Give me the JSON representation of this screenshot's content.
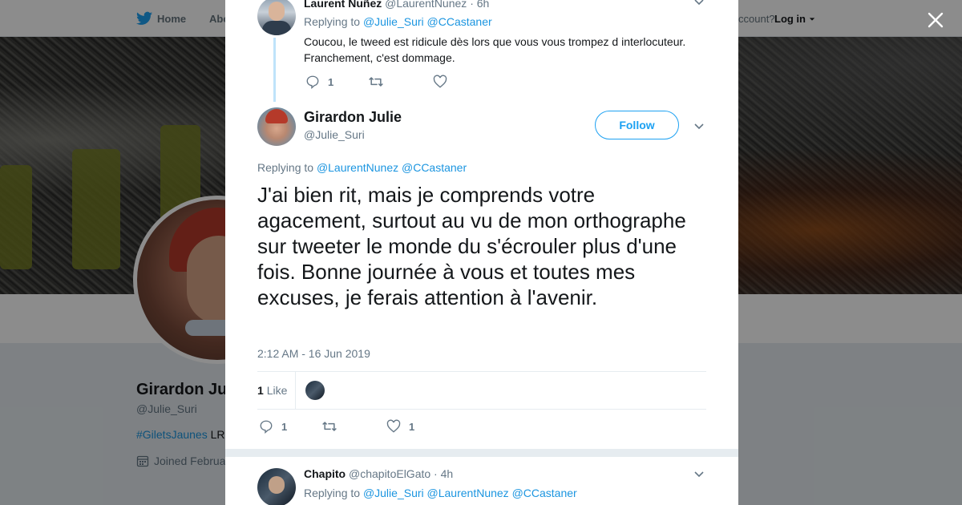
{
  "nav": {
    "home_label": "Home",
    "about_label": "Abo",
    "account_text": "ccount?",
    "login_label": "Log in"
  },
  "profile": {
    "name": "Girardon Ju",
    "handle": "@Julie_Suri",
    "bio_hashtag": "#GiletsJaunes",
    "bio_rest": " LR",
    "joined": "Joined Februa"
  },
  "modal": {
    "parent_tweet": {
      "name": "Laurent Nuñez",
      "handle": "@LaurentNunez",
      "time": "· 6h",
      "replying_prefix": "Replying to",
      "replying_1": "@Julie_Suri",
      "replying_2": "@CCastaner",
      "text_line1": "Coucou, le tweed est ridicule dès lors que vous vous trompez d interlocuteur.",
      "text_line2": "Franchement, c'est dommage.",
      "reply_count": "1",
      "retweet_count": "",
      "like_count": ""
    },
    "main_tweet": {
      "name": "Girardon Julie",
      "handle": "@Julie_Suri",
      "follow_label": "Follow",
      "replying_prefix": "Replying to",
      "replying_1": "@LaurentNunez",
      "replying_2": "@CCastaner",
      "text": "J'ai bien rit, mais je comprends votre agacement, surtout au vu de mon orthographe sur tweeter le monde du s'écrouler plus d'une fois. Bonne journée à vous et toutes mes excuses, je ferais attention à l'avenir.",
      "timestamp": "2:12 AM - 16 Jun 2019",
      "likes_count": "1",
      "likes_label": "Like",
      "reply_count": "1",
      "retweet_count": "",
      "like_count": "1"
    },
    "reply_tweet": {
      "name": "Chapito",
      "handle": "@chapitoElGato",
      "time": "· 4h",
      "replying_prefix": "Replying to",
      "replying_1": "@Julie_Suri",
      "replying_2": "@LaurentNunez",
      "replying_3": "@CCastaner"
    }
  },
  "colors": {
    "twitter_blue": "#1da1f2",
    "link_blue": "#1b95e0",
    "muted": "#657786",
    "thread_line": "#bfe3fa"
  },
  "icons": [
    "twitter-bird-icon",
    "close-icon",
    "reply-icon",
    "retweet-icon",
    "heart-icon",
    "chevron-down-icon",
    "calendar-icon"
  ]
}
